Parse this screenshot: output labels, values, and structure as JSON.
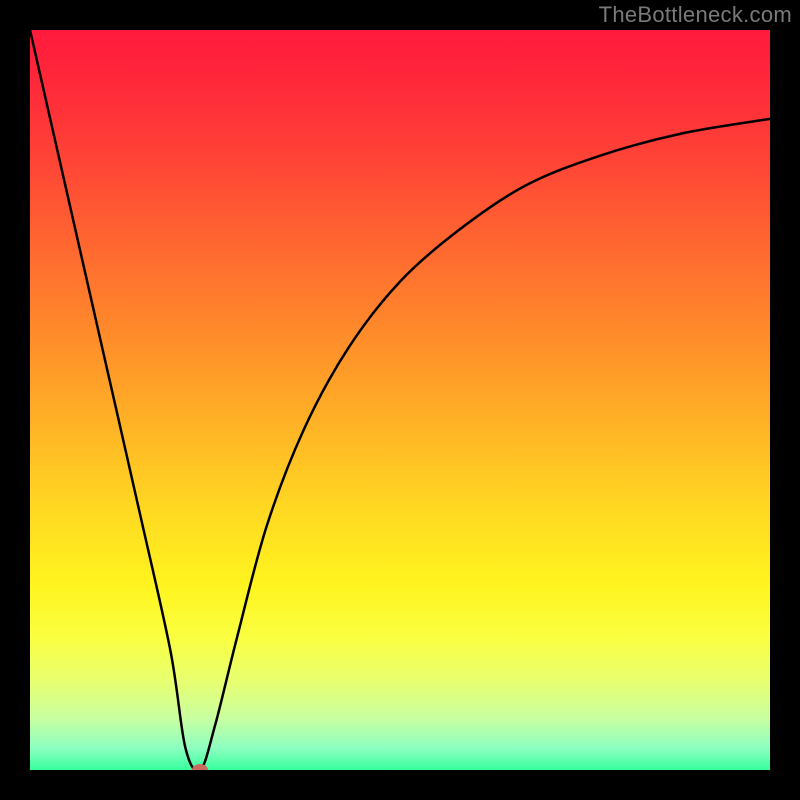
{
  "watermark": "TheBottleneck.com",
  "colors": {
    "frame": "#000000",
    "watermark_text": "#7a7a7a",
    "curve": "#000000",
    "marker": "#c96b5f",
    "gradient_top": "#ff1a3c",
    "gradient_bottom": "#36ff9e"
  },
  "chart_data": {
    "type": "line",
    "title": "",
    "xlabel": "",
    "ylabel": "",
    "xlim": [
      0,
      100
    ],
    "ylim": [
      0,
      100
    ],
    "grid": false,
    "series": [
      {
        "name": "bottleneck-curve",
        "x": [
          0,
          5,
          10,
          15,
          19,
          21,
          23,
          25,
          28,
          32,
          37,
          43,
          50,
          58,
          67,
          77,
          88,
          100
        ],
        "y": [
          100,
          78,
          56,
          34,
          16,
          3,
          0,
          6,
          18,
          33,
          46,
          57,
          66,
          73,
          79,
          83,
          86,
          88
        ]
      }
    ],
    "annotations": [
      {
        "name": "marker",
        "x": 23,
        "y": 0,
        "shape": "ellipse",
        "color": "#c96b5f"
      }
    ],
    "background": {
      "type": "vertical-gradient",
      "description": "red (high) to green (low) gradient indicating bottleneck severity",
      "stops": [
        {
          "pos": 0.0,
          "hex": "#ff1a3c"
        },
        {
          "pos": 0.3,
          "hex": "#ff6a30"
        },
        {
          "pos": 0.65,
          "hex": "#ffd922"
        },
        {
          "pos": 0.85,
          "hex": "#e8ff70"
        },
        {
          "pos": 1.0,
          "hex": "#36ff9e"
        }
      ]
    }
  }
}
